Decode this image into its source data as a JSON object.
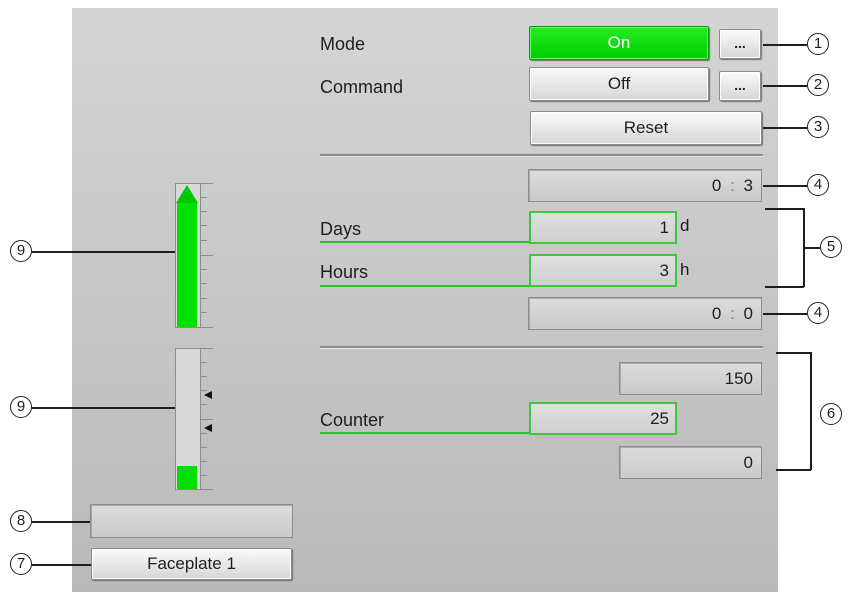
{
  "mode": {
    "label": "Mode",
    "value": "On",
    "more": "..."
  },
  "command": {
    "label": "Command",
    "value": "Off",
    "more": "..."
  },
  "reset": {
    "label": "Reset"
  },
  "time1": {
    "hours": "0",
    "sep": ":",
    "mins": "3"
  },
  "days": {
    "label": "Days",
    "value": "1",
    "unit": "d"
  },
  "hours": {
    "label": "Hours",
    "value": "3",
    "unit": "h"
  },
  "time2": {
    "hours": "0",
    "sep": ":",
    "mins": "0"
  },
  "counter": {
    "label": "Counter",
    "high": "150",
    "value": "25",
    "low": "0"
  },
  "bar1": {
    "level_fraction": 1.0,
    "color": "#00e000"
  },
  "bar2": {
    "level_fraction": 0.17,
    "color": "#00e000"
  },
  "status_display": {
    "text": ""
  },
  "faceplate_button": {
    "label": "Faceplate 1"
  },
  "callouts": [
    "1",
    "2",
    "3",
    "4",
    "5",
    "4",
    "6",
    "9",
    "9",
    "8",
    "7"
  ]
}
